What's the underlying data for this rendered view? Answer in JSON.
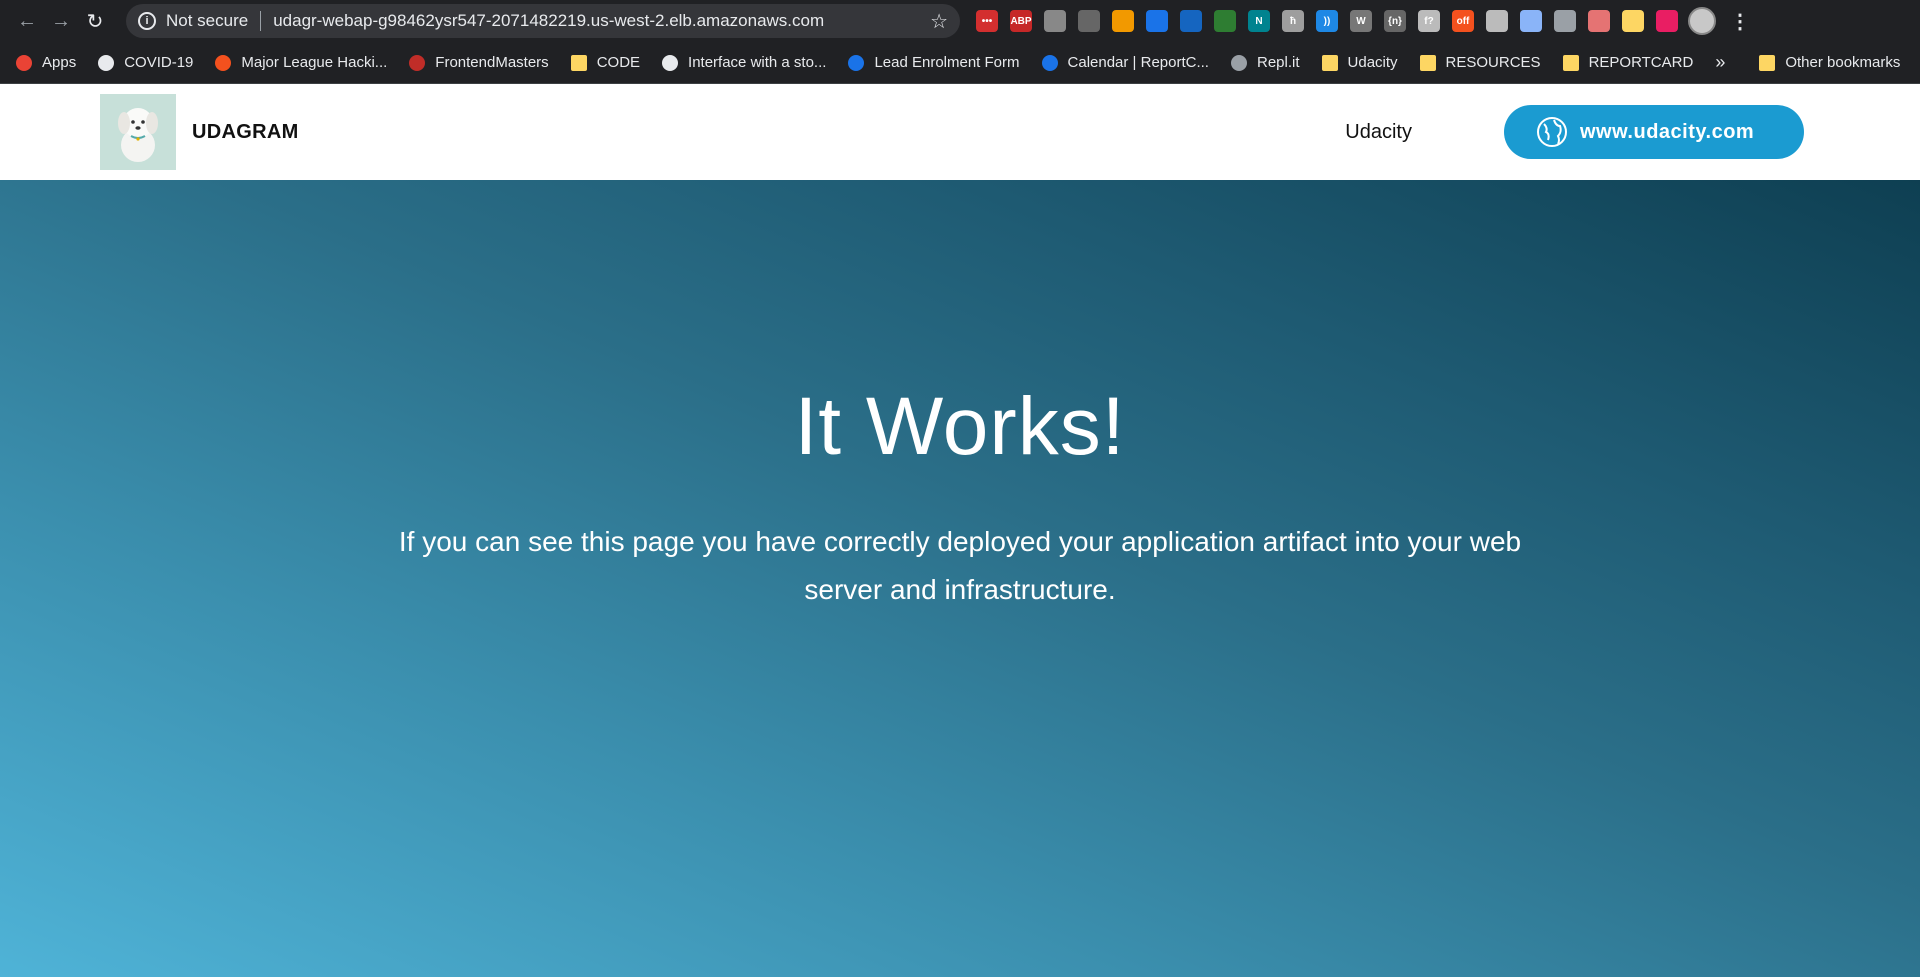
{
  "browser": {
    "not_secure": "Not secure",
    "url": "udagr-webap-g98462ysr547-2071482219.us-west-2.elb.amazonaws.com",
    "extensions": [
      "lastpass-icon",
      "abp-icon",
      "camera-icon",
      "screenshot-icon",
      "play-icon",
      "grid-icon",
      "bitly-icon",
      "paint-icon",
      "notion-icon",
      "h-icon",
      "audio-icon",
      "w-icon",
      "json-icon",
      "formula-icon",
      "dark-off-icon",
      "gear-icon",
      "react-icon",
      "vue-icon",
      "video-icon",
      "note-icon",
      "record-icon"
    ],
    "extension_labels": [
      "•••",
      "ABP",
      "",
      "",
      "",
      "",
      "",
      "",
      "N",
      "ħ",
      "))",
      "W",
      "{n}",
      "f?",
      "off",
      "",
      "",
      "",
      "",
      "",
      ""
    ]
  },
  "bookmarks": [
    {
      "label": "Apps",
      "icon": "apps-grid-icon",
      "color": "#ea4335"
    },
    {
      "label": "COVID-19",
      "icon": "covid-icon",
      "color": "#e8eaed"
    },
    {
      "label": "Major League Hacki...",
      "icon": "mlh-icon",
      "color": "#f4511e"
    },
    {
      "label": "FrontendMasters",
      "icon": "fm-icon",
      "color": "#c02d28"
    },
    {
      "label": "CODE",
      "icon": "folder-icon",
      "color": "#fdd663"
    },
    {
      "label": "Interface with a sto...",
      "icon": "mountain-icon",
      "color": "#e8eaed"
    },
    {
      "label": "Lead Enrolment Form",
      "icon": "form-icon",
      "color": "#1a73e8"
    },
    {
      "label": "Calendar | ReportC...",
      "icon": "calendar-icon",
      "color": "#1a73e8"
    },
    {
      "label": "Repl.it",
      "icon": "replit-icon",
      "color": "#9aa0a6"
    },
    {
      "label": "Udacity",
      "icon": "folder-icon",
      "color": "#fdd663"
    },
    {
      "label": "RESOURCES",
      "icon": "folder-icon",
      "color": "#fdd663"
    },
    {
      "label": "REPORTCARD",
      "icon": "folder-icon",
      "color": "#fdd663"
    }
  ],
  "bookmarks_more": "»",
  "other_bookmarks": "Other bookmarks",
  "site": {
    "brand": "UDAGRAM",
    "nav_link": "Udacity",
    "cta_label": "www.udacity.com",
    "hero_title": "It Works!",
    "hero_text": "If you can see this page you have correctly deployed your application artifact into your web server and infrastructure."
  }
}
